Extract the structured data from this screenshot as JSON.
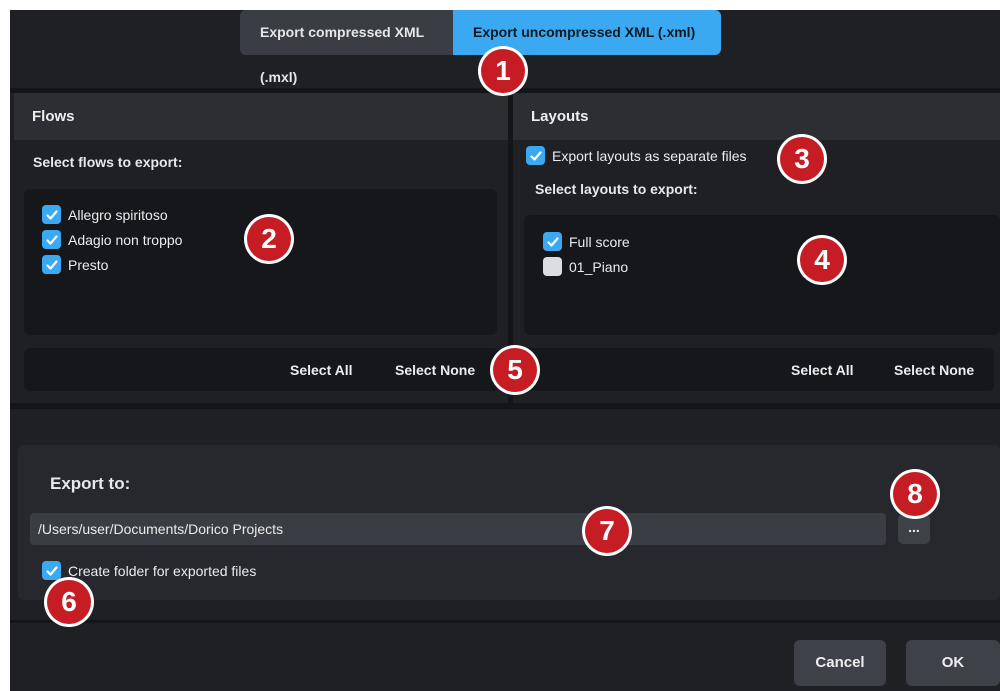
{
  "tabs": {
    "compressed_label": "Export compressed XML (.mxl)",
    "uncompressed_label": "Export uncompressed XML (.xml)"
  },
  "flows_panel": {
    "title": "Flows",
    "prompt": "Select flows to export:",
    "items": [
      {
        "label": "Allegro spiritoso",
        "checked": true
      },
      {
        "label": "Adagio non troppo",
        "checked": true
      },
      {
        "label": "Presto",
        "checked": true
      }
    ],
    "select_all": "Select All",
    "select_none": "Select None"
  },
  "layouts_panel": {
    "title": "Layouts",
    "separate_files_label": "Export layouts as separate files",
    "separate_files_checked": true,
    "prompt": "Select layouts to export:",
    "items": [
      {
        "label": "Full score",
        "checked": true
      },
      {
        "label": "01_Piano",
        "checked": false
      }
    ],
    "select_all": "Select All",
    "select_none": "Select None"
  },
  "export": {
    "heading": "Export to:",
    "path": "/Users/user/Documents/Dorico Projects",
    "browse_label": "...",
    "create_folder_label": "Create folder for exported files",
    "create_folder_checked": true
  },
  "footer": {
    "cancel_label": "Cancel",
    "ok_label": "OK"
  },
  "markers": [
    "1",
    "2",
    "3",
    "4",
    "5",
    "6",
    "7",
    "8"
  ],
  "colors": {
    "accent": "#3aa9f2",
    "marker": "#c51d23",
    "background": "#1f2024"
  }
}
